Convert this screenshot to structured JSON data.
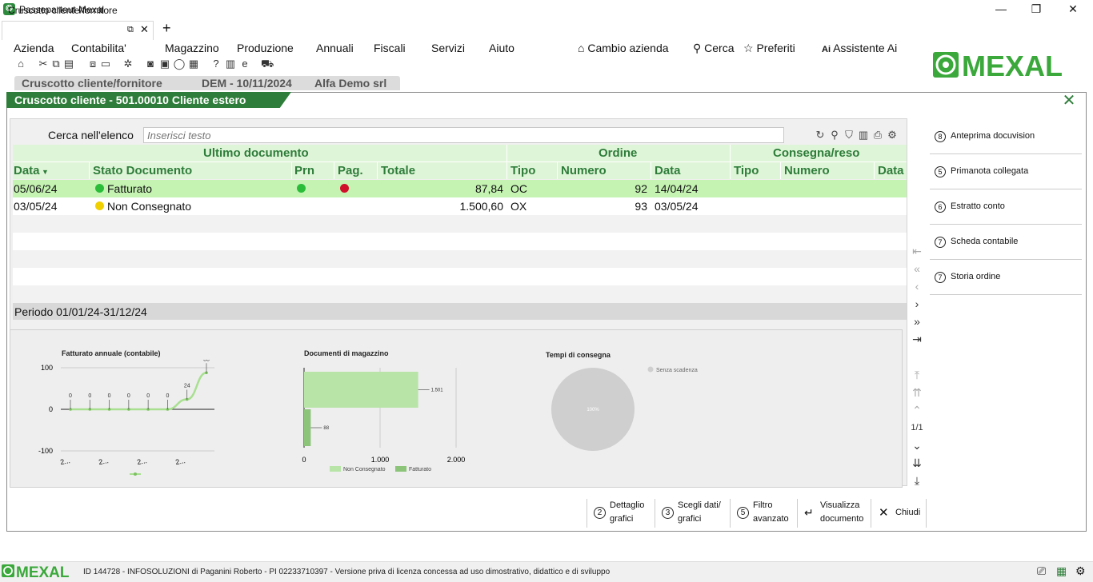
{
  "app": {
    "title": "Passepartout Mexal"
  },
  "window_controls": {
    "minimize": "—",
    "maximize": "❐",
    "close": "✕"
  },
  "tab": {
    "label": "Cruscotto cliente/fornitore",
    "new_tab": "+"
  },
  "menu": {
    "items": [
      "Azienda",
      "Contabilita'",
      "Magazzino",
      "Produzione",
      "Annuali",
      "Fiscali",
      "Servizi",
      "Aiuto"
    ],
    "right": [
      "Cambio azienda",
      "Cerca",
      "Preferiti",
      "Assistente Ai"
    ]
  },
  "logo": {
    "text": "MEXAL",
    "color": "#3aa83a"
  },
  "cockpit": {
    "tab1": "Cruscotto cliente/fornitore",
    "tab2": "DEM - 10/11/2024",
    "tab3": "Alfa Demo srl"
  },
  "window": {
    "title": "Cruscotto cliente - 501.00010 Cliente estero"
  },
  "search": {
    "label": "Cerca nell'elenco",
    "placeholder": "Inserisci testo"
  },
  "grid": {
    "groups": [
      "Ultimo documento",
      "Ordine",
      "Consegna/reso"
    ],
    "columns": [
      "Data",
      "Stato Documento",
      "Prn",
      "Pag.",
      "Totale",
      "Tipo",
      "Numero",
      "Data",
      "Tipo",
      "Numero",
      "Data"
    ],
    "rows": [
      {
        "data": "05/06/24",
        "stato": "Fatturato",
        "stato_color": "#2bbd3a",
        "prn_color": "#2bbd3a",
        "pag_color": "#d0102a",
        "totale": "87,84",
        "tipo": "OC",
        "numero": "92",
        "data_ord": "14/04/24"
      },
      {
        "data": "03/05/24",
        "stato": "Non Consegnato",
        "stato_color": "#f0d000",
        "totale": "1.500,60",
        "tipo": "OX",
        "numero": "93",
        "data_ord": "03/05/24"
      }
    ]
  },
  "periodo": "Periodo 01/01/24-31/12/24",
  "chart_data": [
    {
      "type": "line",
      "title": "Fatturato annuale (contabile)",
      "x": [
        "2...",
        "2...",
        "2...",
        "2..."
      ],
      "yticks": [
        "100",
        "0",
        "-100"
      ],
      "ylim": [
        -100,
        100
      ],
      "values": [
        0,
        0,
        0,
        0,
        0,
        0,
        24,
        88
      ],
      "labels": [
        "0",
        "0",
        "0",
        "0",
        "0",
        "0",
        "24",
        "88"
      ]
    },
    {
      "type": "bar",
      "title": "Documenti di magazzino",
      "orientation": "horizontal",
      "xticks": [
        "0",
        "1.000",
        "2.000"
      ],
      "xlim": [
        0,
        2000
      ],
      "series": [
        {
          "name": "Non Consegnato",
          "color": "#b8e4a8",
          "value": 1501,
          "label": "1.501"
        },
        {
          "name": "Fatturato",
          "color": "#8cc47a",
          "value": 88,
          "label": "88"
        }
      ]
    },
    {
      "type": "pie",
      "title": "Tempi di consegna",
      "slices": [
        {
          "name": "Senza scadenza",
          "value": 100,
          "label": "100%",
          "color": "#cfcfcf"
        }
      ]
    }
  ],
  "nav": {
    "page": "1/1"
  },
  "right_actions": [
    {
      "key": "8",
      "label": "Anteprima docuvision"
    },
    {
      "key": "5",
      "label": "Primanota collegata"
    },
    {
      "key": "6",
      "label": "Estratto conto"
    },
    {
      "key": "7",
      "label": "Scheda contabile"
    },
    {
      "key": "7",
      "label": "Storia ordine"
    }
  ],
  "bottom_actions": [
    {
      "key": "2",
      "label1": "Dettaglio",
      "label2": "grafici"
    },
    {
      "key": "3",
      "label1": "Scegli dati/",
      "label2": "grafici"
    },
    {
      "key": "5",
      "label1": "Filtro",
      "label2": "avanzato"
    },
    {
      "label1": "Visualizza",
      "label2": "documento"
    },
    {
      "label1": "Chiudi"
    }
  ],
  "status": {
    "logo": "MEXAL",
    "text": "ID 144728 - INFOSOLUZIONI di Paganini Roberto - PI 02233710397 - Versione priva di licenza concessa ad uso dimostrativo, didattico e di sviluppo"
  }
}
